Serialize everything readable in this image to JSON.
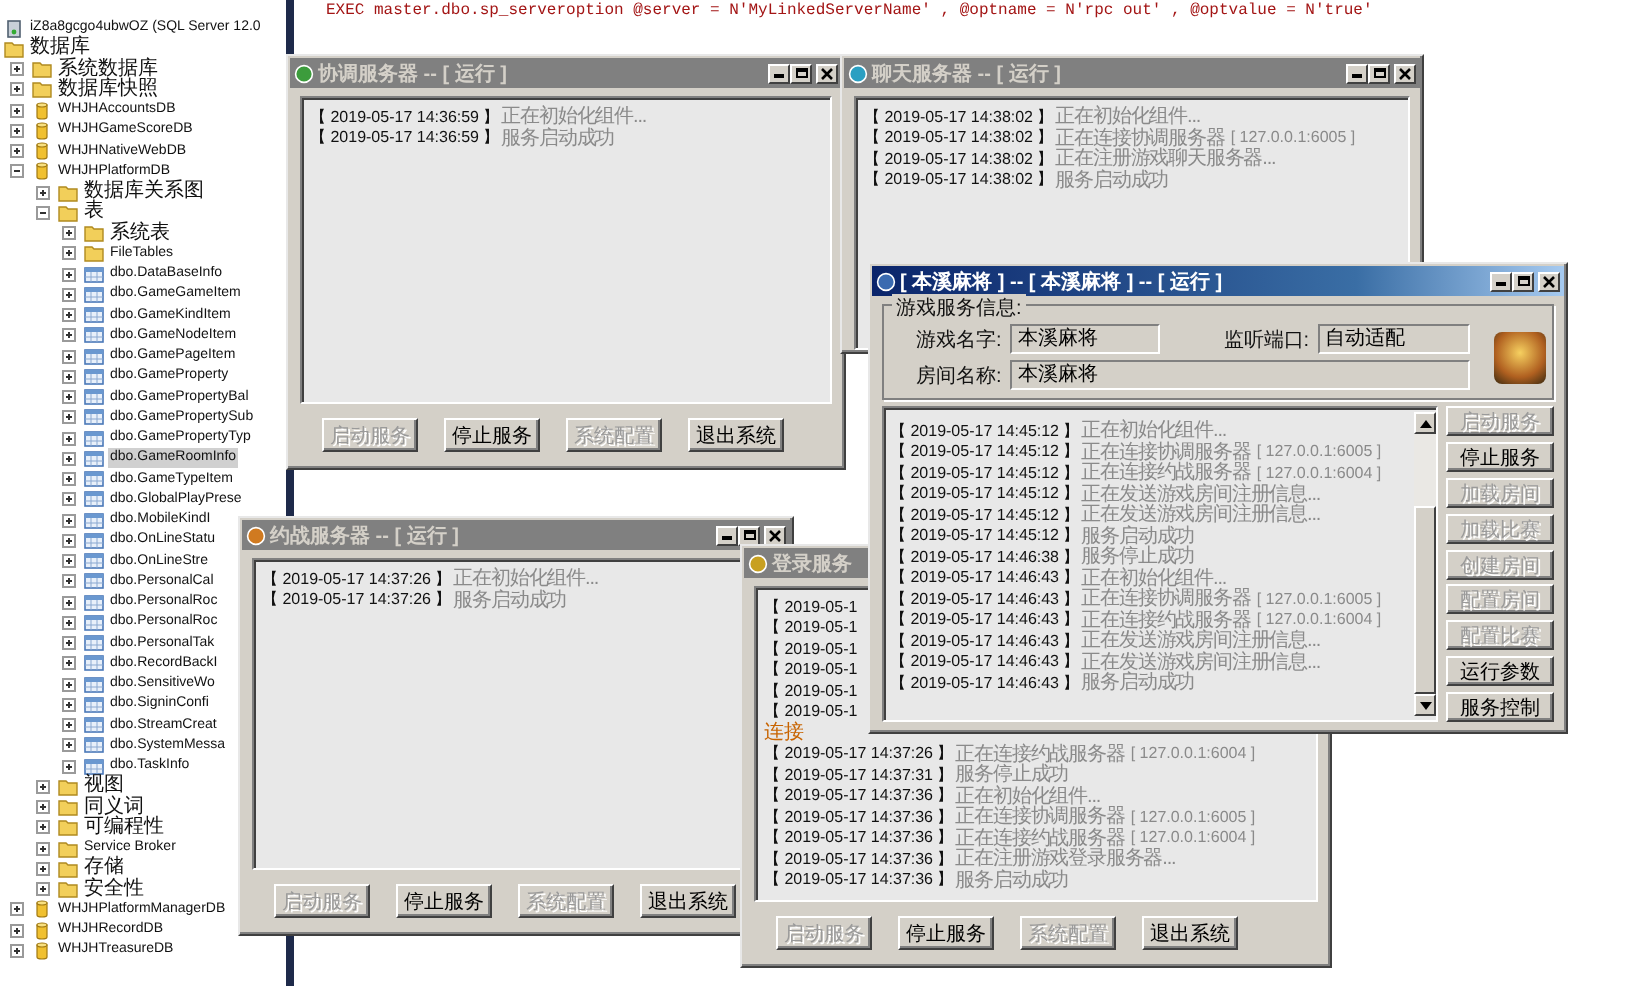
{
  "editor": {
    "code_line": "EXEC master.dbo.sp_serveroption @server = N'MyLinkedServerName' , @optname = N'rpc out' , @optvalue = N'true'"
  },
  "explorer": {
    "items": [
      {
        "label": "iZ8a8gcgo4ubwOZ (SQL Server 12.0",
        "kind": "server",
        "selected": false,
        "children": [
          {
            "label": "数据库",
            "kind": "folder",
            "selected": false,
            "children": [
              {
                "label": "系统数据库",
                "kind": "folder",
                "expanded": false,
                "selected": false
              },
              {
                "label": "数据库快照",
                "kind": "folder",
                "expanded": false,
                "selected": false
              },
              {
                "label": "WHJHAccountsDB",
                "kind": "database",
                "expanded": false,
                "selected": false
              },
              {
                "label": "WHJHGameScoreDB",
                "kind": "database",
                "expanded": false,
                "selected": false
              },
              {
                "label": "WHJHNativeWebDB",
                "kind": "database",
                "expanded": false,
                "selected": false
              },
              {
                "label": "WHJHPlatformDB",
                "kind": "database",
                "expanded": true,
                "selected": false,
                "children": [
                  {
                    "label": "数据库关系图",
                    "kind": "folder",
                    "expanded": false,
                    "selected": false
                  },
                  {
                    "label": "表",
                    "kind": "folder",
                    "expanded": true,
                    "selected": false,
                    "children": [
                      {
                        "label": "系统表",
                        "kind": "folder",
                        "expanded": false,
                        "selected": false
                      },
                      {
                        "label": "FileTables",
                        "kind": "folder",
                        "expanded": false,
                        "selected": false
                      },
                      {
                        "label": "dbo.DataBaseInfo",
                        "kind": "table",
                        "expanded": false,
                        "selected": false
                      },
                      {
                        "label": "dbo.GameGameItem",
                        "kind": "table",
                        "expanded": false,
                        "selected": false
                      },
                      {
                        "label": "dbo.GameKindItem",
                        "kind": "table",
                        "expanded": false,
                        "selected": false
                      },
                      {
                        "label": "dbo.GameNodeItem",
                        "kind": "table",
                        "expanded": false,
                        "selected": false
                      },
                      {
                        "label": "dbo.GamePageItem",
                        "kind": "table",
                        "expanded": false,
                        "selected": false
                      },
                      {
                        "label": "dbo.GameProperty",
                        "kind": "table",
                        "expanded": false,
                        "selected": false
                      },
                      {
                        "label": "dbo.GamePropertyBal",
                        "kind": "table",
                        "expanded": false,
                        "selected": false
                      },
                      {
                        "label": "dbo.GamePropertySub",
                        "kind": "table",
                        "expanded": false,
                        "selected": false
                      },
                      {
                        "label": "dbo.GamePropertyTyp",
                        "kind": "table",
                        "expanded": false,
                        "selected": false
                      },
                      {
                        "label": "dbo.GameRoomInfo",
                        "kind": "table",
                        "expanded": false,
                        "selected": true
                      },
                      {
                        "label": "dbo.GameTypeItem",
                        "kind": "table",
                        "expanded": false,
                        "selected": false
                      },
                      {
                        "label": "dbo.GlobalPlayPrese",
                        "kind": "table",
                        "expanded": false,
                        "selected": false
                      },
                      {
                        "label": "dbo.MobileKindI",
                        "kind": "table",
                        "expanded": false,
                        "selected": false
                      },
                      {
                        "label": "dbo.OnLineStatu",
                        "kind": "table",
                        "expanded": false,
                        "selected": false
                      },
                      {
                        "label": "dbo.OnLineStre",
                        "kind": "table",
                        "expanded": false,
                        "selected": false
                      },
                      {
                        "label": "dbo.PersonalCal",
                        "kind": "table",
                        "expanded": false,
                        "selected": false
                      },
                      {
                        "label": "dbo.PersonalRoc",
                        "kind": "table",
                        "expanded": false,
                        "selected": false
                      },
                      {
                        "label": "dbo.PersonalRoc",
                        "kind": "table",
                        "expanded": false,
                        "selected": false
                      },
                      {
                        "label": "dbo.PersonalTak",
                        "kind": "table",
                        "expanded": false,
                        "selected": false
                      },
                      {
                        "label": "dbo.RecordBackI",
                        "kind": "table",
                        "expanded": false,
                        "selected": false
                      },
                      {
                        "label": "dbo.SensitiveWo",
                        "kind": "table",
                        "expanded": false,
                        "selected": false
                      },
                      {
                        "label": "dbo.SigninConfi",
                        "kind": "table",
                        "expanded": false,
                        "selected": false
                      },
                      {
                        "label": "dbo.StreamCreat",
                        "kind": "table",
                        "expanded": false,
                        "selected": false
                      },
                      {
                        "label": "dbo.SystemMessa",
                        "kind": "table",
                        "expanded": false,
                        "selected": false
                      },
                      {
                        "label": "dbo.TaskInfo",
                        "kind": "table",
                        "expanded": false,
                        "selected": false
                      }
                    ]
                  },
                  {
                    "label": "视图",
                    "kind": "folder",
                    "expanded": false,
                    "selected": false
                  },
                  {
                    "label": "同义词",
                    "kind": "folder",
                    "expanded": false,
                    "selected": false
                  },
                  {
                    "label": "可编程性",
                    "kind": "folder",
                    "expanded": false,
                    "selected": false
                  },
                  {
                    "label": "Service Broker",
                    "kind": "folder",
                    "expanded": false,
                    "selected": false
                  },
                  {
                    "label": "存储",
                    "kind": "folder",
                    "expanded": false,
                    "selected": false
                  },
                  {
                    "label": "安全性",
                    "kind": "folder",
                    "expanded": false,
                    "selected": false
                  }
                ]
              },
              {
                "label": "WHJHPlatformManagerDB",
                "kind": "database",
                "expanded": false,
                "selected": false
              },
              {
                "label": "WHJHRecordDB",
                "kind": "database",
                "expanded": false,
                "selected": false
              },
              {
                "label": "WHJHTreasureDB",
                "kind": "database",
                "expanded": false,
                "selected": false
              }
            ]
          }
        ]
      }
    ]
  },
  "windows": [
    {
      "kind": "log",
      "title": "协调服务器 -- [ 运行 ]",
      "active": false,
      "log": [
        {
          "stamp": "【 2019-05-17 14:36:59 】",
          "message": "正在初始化组件..."
        },
        {
          "stamp": "【 2019-05-17 14:36:59 】",
          "message": "服务启动成功"
        }
      ],
      "buttons": [
        {
          "label": "启动服务",
          "disabled": true
        },
        {
          "label": "停止服务",
          "disabled": false
        },
        {
          "label": "系统配置",
          "disabled": true
        },
        {
          "label": "退出系统",
          "disabled": false
        }
      ]
    },
    {
      "kind": "log",
      "title": "聊天服务器 -- [ 运行 ]",
      "active": false,
      "log": [
        {
          "stamp": "【 2019-05-17 14:38:02 】",
          "message": "正在初始化组件..."
        },
        {
          "stamp": "【 2019-05-17 14:38:02 】",
          "message": "正在连接协调服务器",
          "detail": "[ 127.0.0.1:6005 ]"
        },
        {
          "stamp": "【 2019-05-17 14:38:02 】",
          "message": "正在注册游戏聊天服务器..."
        },
        {
          "stamp": "【 2019-05-17 14:38:02 】",
          "message": "服务启动成功"
        }
      ]
    },
    {
      "kind": "log",
      "title": "约战服务器 -- [ 运行 ]",
      "active": false,
      "log": [
        {
          "stamp": "【 2019-05-17 14:37:26 】",
          "message": "正在初始化组件..."
        },
        {
          "stamp": "【 2019-05-17 14:37:26 】",
          "message": "服务启动成功"
        }
      ],
      "buttons": [
        {
          "label": "启动服务",
          "disabled": true
        },
        {
          "label": "停止服务",
          "disabled": false
        },
        {
          "label": "系统配置",
          "disabled": true
        },
        {
          "label": "退出系统",
          "disabled": false
        }
      ]
    },
    {
      "kind": "log",
      "title": "登录服务",
      "active": false,
      "log": [
        {
          "kind": "entry",
          "stamp": "【 2019-05-1"
        },
        {
          "kind": "entry",
          "stamp": "【 2019-05-1"
        },
        {
          "kind": "entry",
          "stamp": "【 2019-05-1"
        },
        {
          "kind": "entry",
          "stamp": "【 2019-05-1"
        },
        {
          "kind": "entry",
          "stamp": "【 2019-05-1"
        },
        {
          "kind": "entry",
          "stamp": "【 2019-05-1"
        },
        {
          "kind": "note",
          "message": "连接"
        },
        {
          "kind": "entry",
          "stamp": "【 2019-05-17 14:37:26 】",
          "message": "正在连接约战服务器",
          "detail": "[ 127.0.0.1:6004 ]"
        },
        {
          "kind": "entry",
          "stamp": "【 2019-05-17 14:37:31 】",
          "message": "服务停止成功"
        },
        {
          "kind": "entry",
          "stamp": "【 2019-05-17 14:37:36 】",
          "message": "正在初始化组件..."
        },
        {
          "kind": "entry",
          "stamp": "【 2019-05-17 14:37:36 】",
          "message": "正在连接协调服务器",
          "detail": "[ 127.0.0.1:6005 ]"
        },
        {
          "kind": "entry",
          "stamp": "【 2019-05-17 14:37:36 】",
          "message": "正在连接约战服务器",
          "detail": "[ 127.0.0.1:6004 ]"
        },
        {
          "kind": "entry",
          "stamp": "【 2019-05-17 14:37:36 】",
          "message": "正在注册游戏登录服务器..."
        },
        {
          "kind": "entry",
          "stamp": "【 2019-05-17 14:37:36 】",
          "message": "服务启动成功"
        }
      ],
      "buttons": [
        {
          "label": "启动服务",
          "disabled": true
        },
        {
          "label": "停止服务",
          "disabled": false
        },
        {
          "label": "系统配置",
          "disabled": true
        },
        {
          "label": "退出系统",
          "disabled": false
        }
      ]
    },
    {
      "kind": "game",
      "title": "[ 本溪麻将 ] -- [ 本溪麻将 ] -- [ 运行 ]",
      "active": true,
      "group_title": "游戏服务信息:",
      "fields": [
        {
          "label": "游戏名字:",
          "value": "本溪麻将"
        },
        {
          "label": "监听端口:",
          "value": "自动适配"
        },
        {
          "label": "房间名称:",
          "value": "本溪麻将"
        }
      ],
      "log": [
        {
          "stamp": "【 2019-05-17 14:45:12 】",
          "message": "正在初始化组件..."
        },
        {
          "stamp": "【 2019-05-17 14:45:12 】",
          "message": "正在连接协调服务器",
          "detail": "[ 127.0.0.1:6005 ]"
        },
        {
          "stamp": "【 2019-05-17 14:45:12 】",
          "message": "正在连接约战服务器",
          "detail": "[ 127.0.0.1:6004 ]"
        },
        {
          "stamp": "【 2019-05-17 14:45:12 】",
          "message": "正在发送游戏房间注册信息..."
        },
        {
          "stamp": "【 2019-05-17 14:45:12 】",
          "message": "正在发送游戏房间注册信息..."
        },
        {
          "stamp": "【 2019-05-17 14:45:12 】",
          "message": "服务启动成功"
        },
        {
          "stamp": "【 2019-05-17 14:46:38 】",
          "message": "服务停止成功"
        },
        {
          "stamp": "【 2019-05-17 14:46:43 】",
          "message": "正在初始化组件..."
        },
        {
          "stamp": "【 2019-05-17 14:46:43 】",
          "message": "正在连接协调服务器",
          "detail": "[ 127.0.0.1:6005 ]"
        },
        {
          "stamp": "【 2019-05-17 14:46:43 】",
          "message": "正在连接约战服务器",
          "detail": "[ 127.0.0.1:6004 ]"
        },
        {
          "stamp": "【 2019-05-17 14:46:43 】",
          "message": "正在发送游戏房间注册信息..."
        },
        {
          "stamp": "【 2019-05-17 14:46:43 】",
          "message": "正在发送游戏房间注册信息..."
        },
        {
          "stamp": "【 2019-05-17 14:46:43 】",
          "message": "服务启动成功"
        }
      ],
      "buttons": [
        {
          "label": "启动服务",
          "disabled": true
        },
        {
          "label": "停止服务",
          "disabled": false
        },
        {
          "label": "加载房间",
          "disabled": true
        },
        {
          "label": "加载比赛",
          "disabled": true
        },
        {
          "label": "创建房间",
          "disabled": true
        },
        {
          "label": "配置房间",
          "disabled": true
        },
        {
          "label": "配置比赛",
          "disabled": true
        },
        {
          "label": "运行参数",
          "disabled": false
        },
        {
          "label": "服务控制",
          "disabled": false
        }
      ]
    }
  ]
}
